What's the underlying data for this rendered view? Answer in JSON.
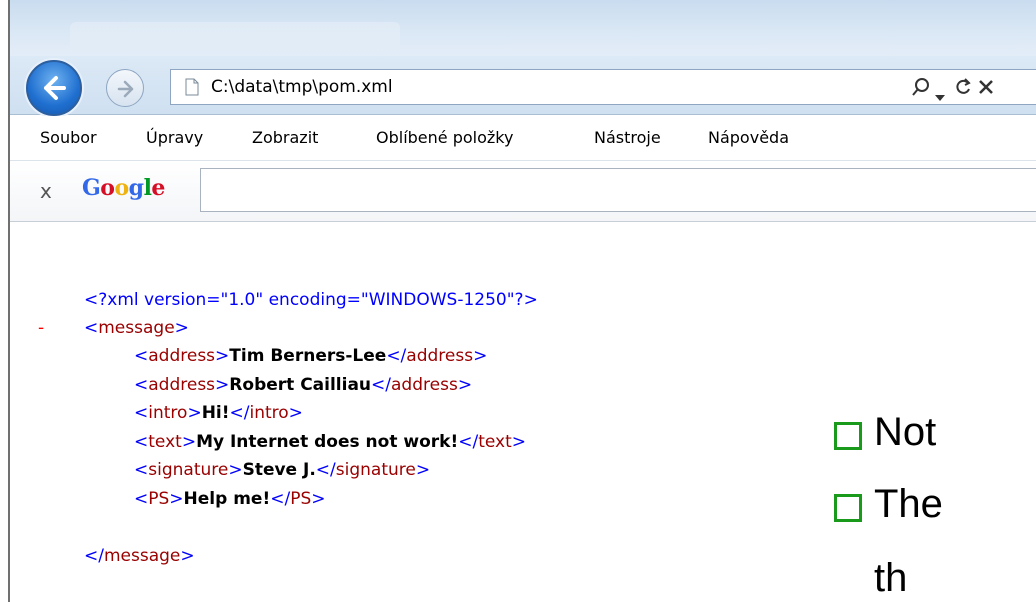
{
  "address": {
    "url": "C:\\data\\tmp\\pom.xml",
    "tools": [
      "search-icon",
      "dropdown-icon",
      "refresh-icon",
      "stop-icon"
    ]
  },
  "menu": [
    "Soubor",
    "Úpravy",
    "Zobrazit",
    "Oblíbené položky",
    "Nástroje",
    "Nápověda"
  ],
  "google_toolbar": {
    "close": "x",
    "logo_letters": [
      "G",
      "o",
      "o",
      "g",
      "l",
      "e"
    ],
    "logo_colors": [
      "#3369e8",
      "#d50f25",
      "#eeb211",
      "#3369e8",
      "#009925",
      "#d50f25"
    ]
  },
  "xml": {
    "declaration": "<?xml version=\"1.0\" encoding=\"WINDOWS-1250\"?>",
    "collapse": "-",
    "root_open": "message",
    "root_close": "message",
    "elements": [
      {
        "tag": "address",
        "text": "Tim Berners-Lee"
      },
      {
        "tag": "address",
        "text": "Robert Cailliau"
      },
      {
        "tag": "intro",
        "text": "Hi!"
      },
      {
        "tag": "text",
        "text": "My Internet does not work!"
      },
      {
        "tag": "signature",
        "text": "Steve J."
      },
      {
        "tag": "PS",
        "text": "Help me!"
      }
    ]
  },
  "slide_bullets": [
    "Not",
    "The",
    "th"
  ],
  "colors": {
    "bullet_border": "#1a9a1a",
    "tag": "#990000",
    "bracket": "#0000ff"
  }
}
